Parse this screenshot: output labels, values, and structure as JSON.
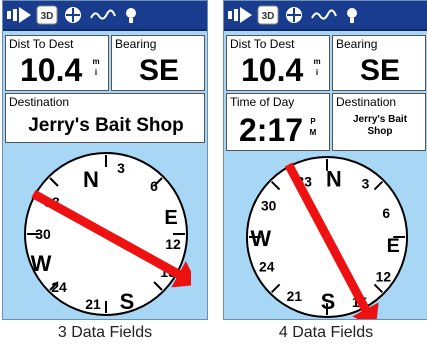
{
  "status_icons": [
    "gps-signal-icon",
    "3d-fix-icon",
    "navigation-target-icon",
    "track-icon",
    "backlight-icon"
  ],
  "status_labels": {
    "three_d": "3D"
  },
  "colors": {
    "screen_background": "#a7d7f5",
    "status_bar": "#1a3c8e",
    "compass_face": "#ffffff",
    "bearing_arrow": "#ee1111"
  },
  "screens": [
    {
      "caption": "3 Data Fields",
      "fields": {
        "dist_label": "Dist To Dest",
        "dist_value": "10.4",
        "dist_unit": [
          "m",
          "i"
        ],
        "bearing_label": "Bearing",
        "bearing_value": "SE",
        "destination_label": "Destination",
        "destination_value": "Jerry's Bait Shop"
      },
      "compass": {
        "cardinals": {
          "north": "N",
          "east": "E",
          "south": "S",
          "west": "W"
        },
        "numerals": [
          "3",
          "6",
          "12",
          "15",
          "21",
          "24",
          "30",
          "33"
        ],
        "bearing_deg": 119
      }
    },
    {
      "caption": "4 Data Fields",
      "fields": {
        "dist_label": "Dist To Dest",
        "dist_value": "10.4",
        "dist_unit": [
          "m",
          "i"
        ],
        "bearing_label": "Bearing",
        "bearing_value": "SE",
        "time_label": "Time of Day",
        "time_value": "2:17",
        "time_unit": [
          "P",
          "M"
        ],
        "destination_label": "Destination",
        "destination_value_lines": [
          "Jerry's Bait",
          "Shop"
        ]
      },
      "compass": {
        "cardinals": {
          "north": "N",
          "east": "E",
          "south": "S",
          "west": "W"
        },
        "numerals": [
          "3",
          "6",
          "12",
          "15",
          "21",
          "24",
          "30",
          "33"
        ],
        "bearing_deg": 152
      }
    }
  ]
}
